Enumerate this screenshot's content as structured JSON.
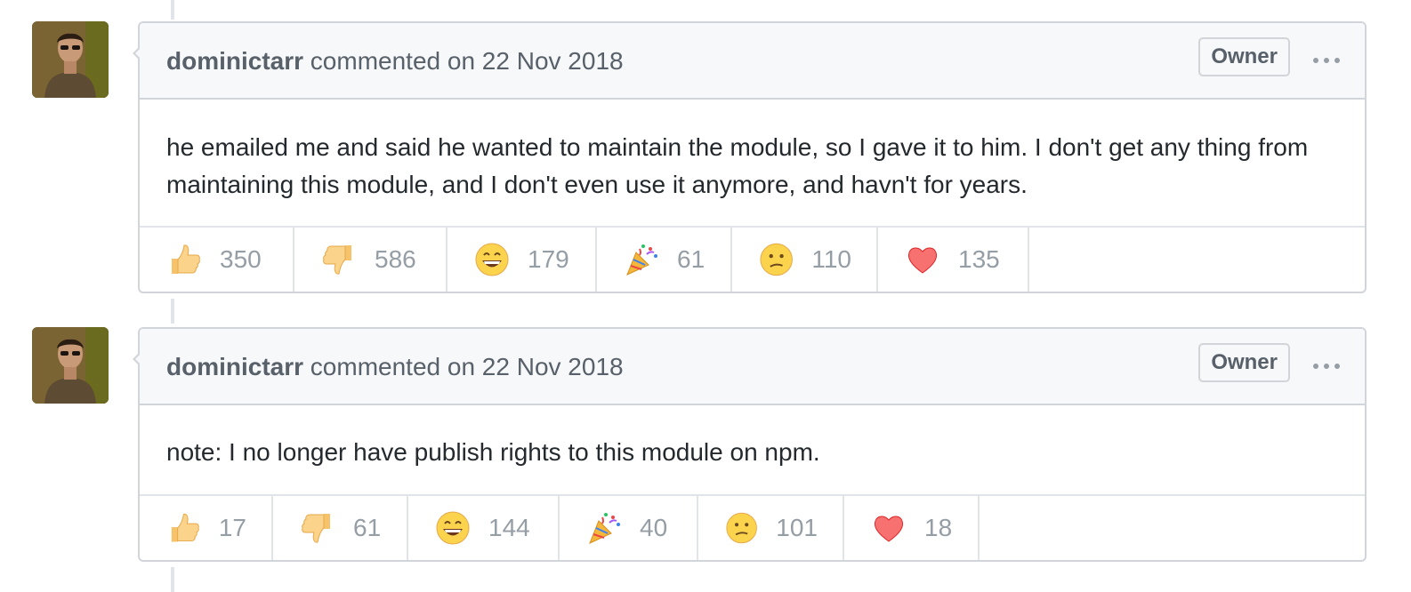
{
  "comments": [
    {
      "author": "dominictarr",
      "action": " commented on 22 Nov 2018",
      "badge": "Owner",
      "body": "he emailed me and said he wanted to maintain the module, so I gave it to him. I don't get any thing from maintaining this module, and I don't even use it anymore, and havn't for years.",
      "reactions": [
        {
          "icon": "thumbs-up",
          "count": "350"
        },
        {
          "icon": "thumbs-down",
          "count": "586"
        },
        {
          "icon": "laugh",
          "count": "179"
        },
        {
          "icon": "hooray",
          "count": "61"
        },
        {
          "icon": "confused",
          "count": "110"
        },
        {
          "icon": "heart",
          "count": "135"
        }
      ]
    },
    {
      "author": "dominictarr",
      "action": " commented on 22 Nov 2018",
      "badge": "Owner",
      "body": "note: I no longer have publish rights to this module on npm.",
      "reactions": [
        {
          "icon": "thumbs-up",
          "count": "17"
        },
        {
          "icon": "thumbs-down",
          "count": "61"
        },
        {
          "icon": "laugh",
          "count": "144"
        },
        {
          "icon": "hooray",
          "count": "40"
        },
        {
          "icon": "confused",
          "count": "101"
        },
        {
          "icon": "heart",
          "count": "18"
        }
      ]
    }
  ],
  "colors": {
    "border": "#d1d5da",
    "header_bg": "#f6f8fa",
    "muted_text": "#586069",
    "count_text": "#959da5"
  }
}
